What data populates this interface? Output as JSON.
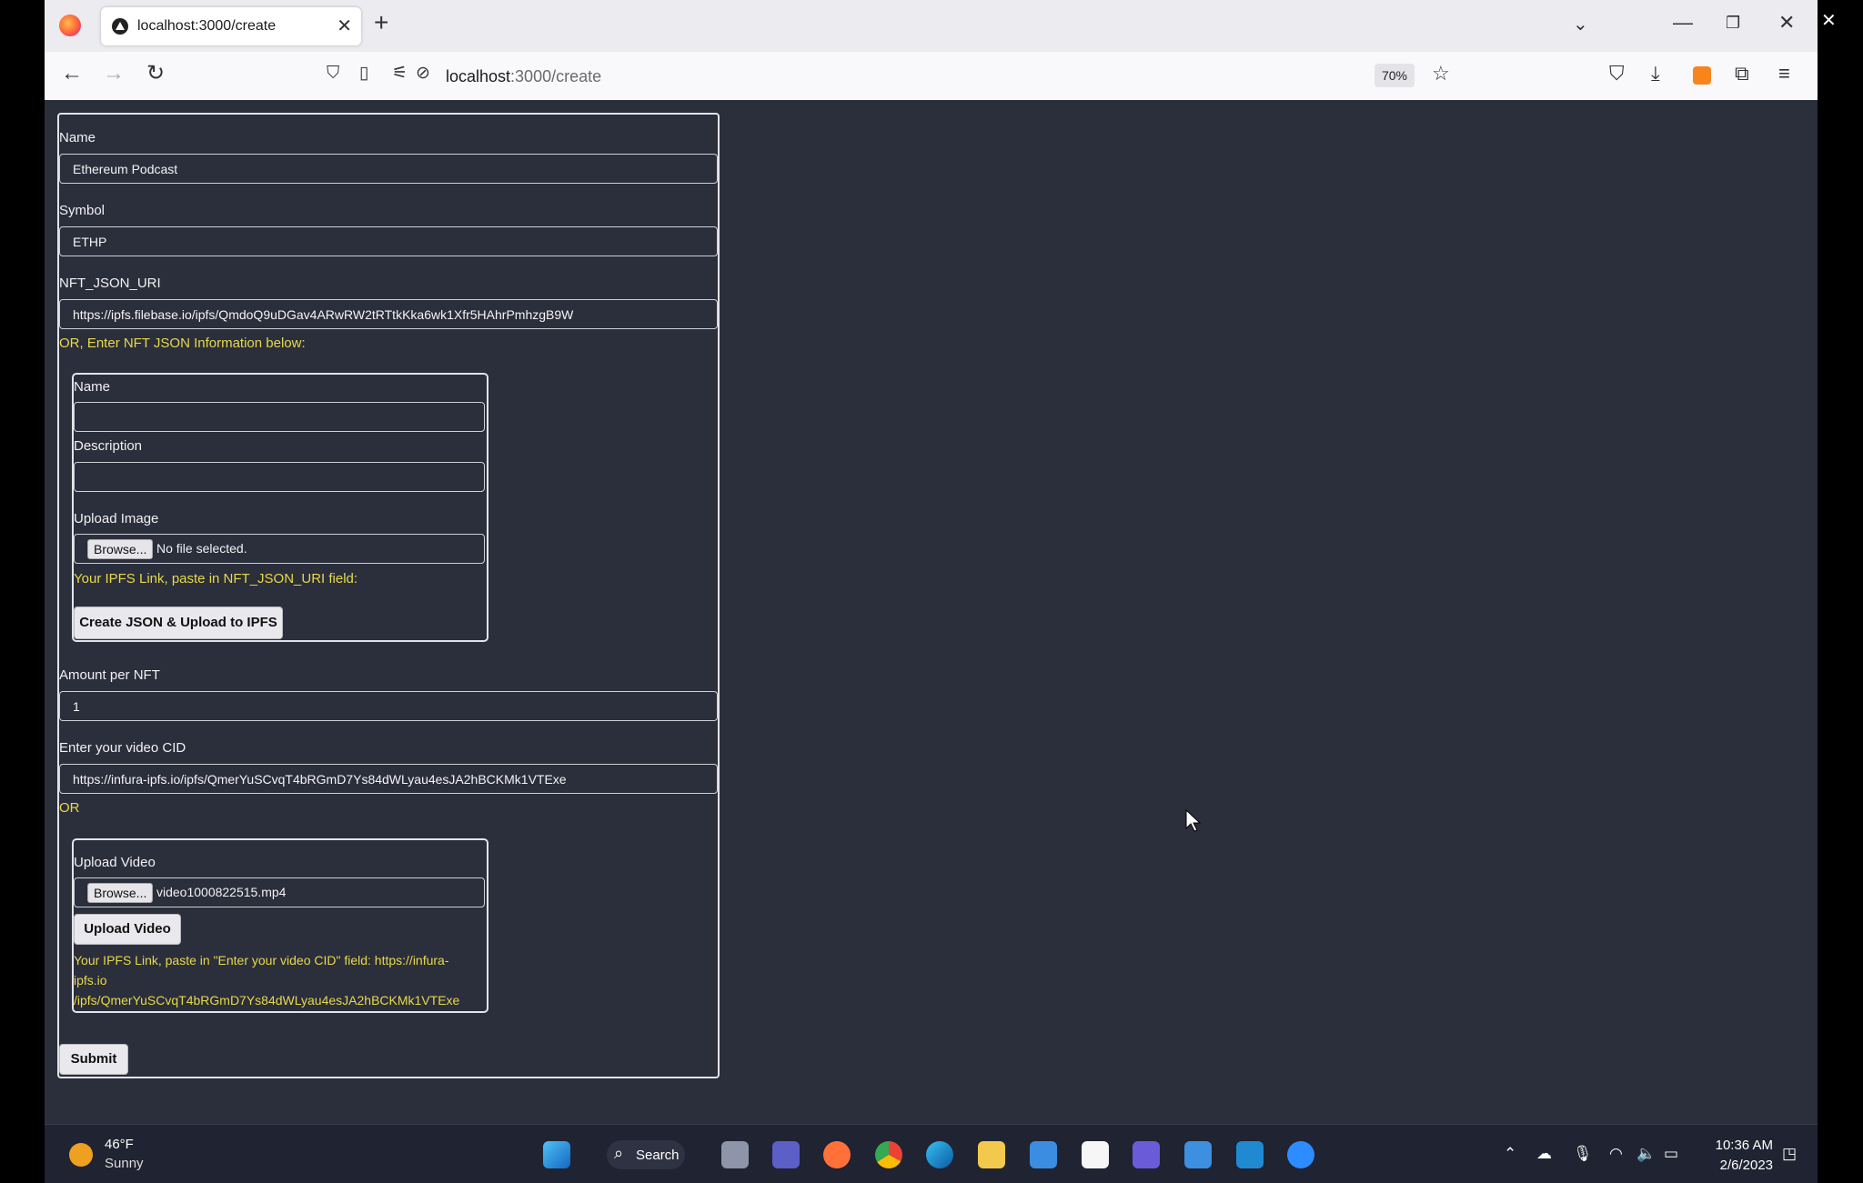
{
  "browser": {
    "tab_title": "localhost:3000/create",
    "url_host": "localhost",
    "url_path": ":3000/create",
    "zoom": "70%"
  },
  "form": {
    "name_label": "Name",
    "name_value": "Ethereum Podcast",
    "symbol_label": "Symbol",
    "symbol_value": "ETHP",
    "uri_label": "NFT_JSON_URI",
    "uri_value": "https://ipfs.filebase.io/ipfs/QmdoQ9uDGav4ARwRW2tRTtkKka6wk1Xfr5HAhrPmhzgB9W",
    "or_json_text": "OR, Enter NFT JSON Information below:",
    "json_section": {
      "name_label": "Name",
      "name_value": "",
      "description_label": "Description",
      "description_value": "",
      "upload_image_label": "Upload Image",
      "browse_label": "Browse...",
      "image_file": "No file selected.",
      "ipfs_hint": "Your IPFS Link, paste in NFT_JSON_URI field:",
      "create_button": "Create JSON & Upload to IPFS"
    },
    "amount_label": "Amount per NFT",
    "amount_value": "1",
    "video_cid_label": "Enter your video CID",
    "video_cid_value": "https://infura-ipfs.io/ipfs/QmerYuSCvqT4bRGmD7Ys84dWLyau4esJA2hBCKMk1VTExe",
    "or_text": "OR",
    "video_section": {
      "upload_video_label": "Upload Video",
      "browse_label": "Browse...",
      "video_file": "video1000822515.mp4",
      "upload_button": "Upload Video",
      "ipfs_hint_line1": "Your IPFS Link, paste in \"Enter your video CID\" field: https://infura-",
      "ipfs_hint_line2": "ipfs.io",
      "ipfs_hint_line3": "/ipfs/QmerYuSCvqT4bRGmD7Ys84dWLyau4esJA2hBCKMk1VTExe"
    },
    "submit_button": "Submit"
  },
  "taskbar": {
    "weather_temp": "46°F",
    "weather_desc": "Sunny",
    "search_label": "Search",
    "time": "10:36 AM",
    "date": "2/6/2023"
  }
}
